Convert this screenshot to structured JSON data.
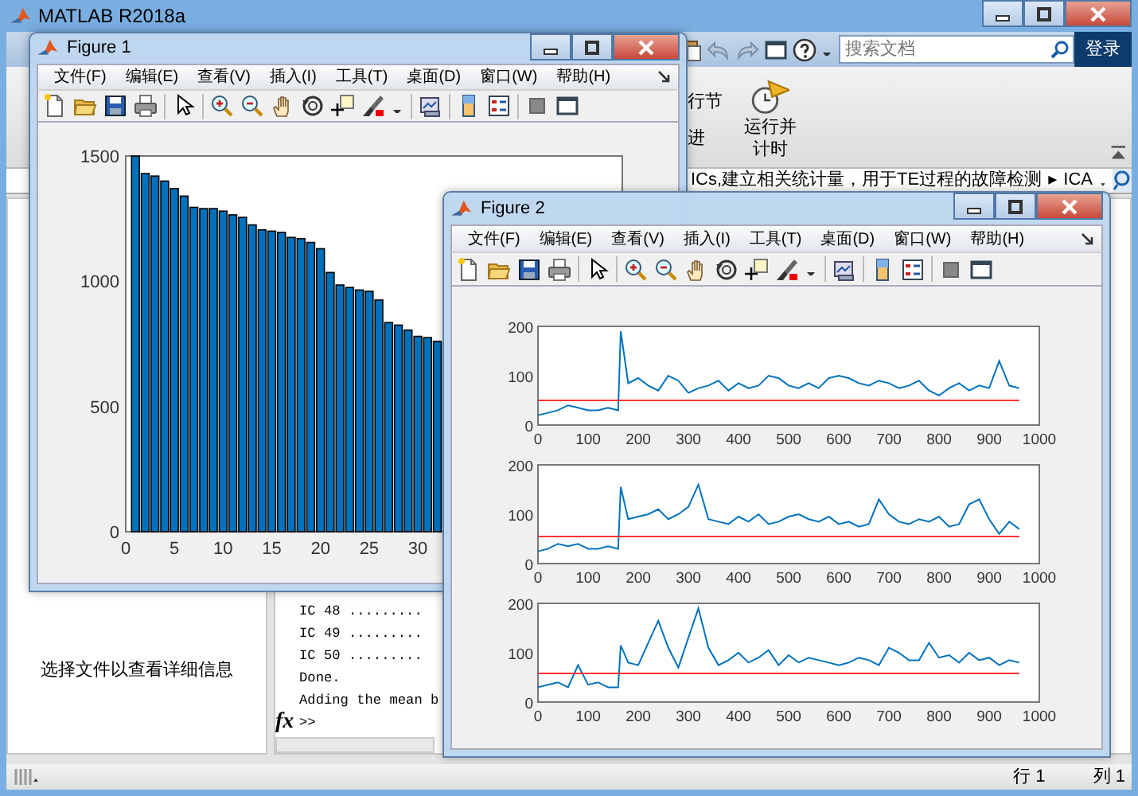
{
  "main_window": {
    "title": "MATLAB R2018a"
  },
  "search": {
    "placeholder": "搜索文档"
  },
  "login_button": "登录",
  "ribbon": {
    "labels": [
      "行节",
      "进"
    ],
    "run_and_time": "运行并计时"
  },
  "address_bar": {
    "path": "ICs,建立相关统计量，用于TE过程的故障检测",
    "separator": "▸",
    "folder": "ICA"
  },
  "details_panel": {
    "message": "选择文件以查看详细信息"
  },
  "command_window": {
    "lines": [
      "IC 48 .........",
      "IC 49 .........",
      "IC 50 .........",
      "Done.",
      "Adding the mean b"
    ],
    "fx": "fx",
    "prompt": ">>"
  },
  "status_bar": {
    "line": "行 1",
    "column": "列 1"
  },
  "figures": [
    {
      "title": "Figure 1",
      "kind": "bar",
      "menu": [
        "文件(F)",
        "编辑(E)",
        "查看(V)",
        "插入(I)",
        "工具(T)",
        "桌面(D)",
        "窗口(W)",
        "帮助(H)"
      ],
      "chart_data": {
        "type": "bar",
        "x": [
          1,
          2,
          3,
          4,
          5,
          6,
          7,
          8,
          9,
          10,
          11,
          12,
          13,
          14,
          15,
          16,
          17,
          18,
          19,
          20,
          21,
          22,
          23,
          24,
          25,
          26,
          27,
          28,
          29,
          30,
          31,
          32
        ],
        "values": [
          1500,
          1430,
          1420,
          1400,
          1370,
          1340,
          1295,
          1290,
          1290,
          1280,
          1265,
          1255,
          1225,
          1205,
          1200,
          1195,
          1175,
          1170,
          1155,
          1130,
          1035,
          985,
          975,
          965,
          960,
          925,
          835,
          825,
          805,
          780,
          775,
          760
        ],
        "xlim": [
          0,
          51
        ],
        "ylim": [
          0,
          1500
        ],
        "xticks": [
          0,
          5,
          10,
          15,
          20,
          25,
          30
        ],
        "yticks": [
          0,
          500,
          1000,
          1500
        ]
      }
    },
    {
      "title": "Figure 2",
      "kind": "subplots",
      "menu": [
        "文件(F)",
        "编辑(E)",
        "查看(V)",
        "插入(I)",
        "工具(T)",
        "桌面(D)",
        "窗口(W)",
        "帮助(H)"
      ],
      "subplots": [
        {
          "chart_data": {
            "type": "line",
            "x": [
              0,
              20,
              40,
              60,
              80,
              100,
              120,
              140,
              160,
              165,
              180,
              200,
              220,
              240,
              260,
              280,
              300,
              320,
              340,
              360,
              380,
              400,
              420,
              440,
              460,
              480,
              500,
              520,
              540,
              560,
              580,
              600,
              620,
              640,
              660,
              680,
              700,
              720,
              740,
              760,
              780,
              800,
              820,
              840,
              860,
              880,
              900,
              920,
              940,
              960
            ],
            "series": [
              {
                "color": "#0072bd",
                "values": [
                  20,
                  25,
                  30,
                  40,
                  35,
                  30,
                  30,
                  35,
                  30,
                  190,
                  85,
                  95,
                  80,
                  70,
                  100,
                  90,
                  65,
                  75,
                  80,
                  90,
                  70,
                  85,
                  75,
                  80,
                  100,
                  95,
                  80,
                  75,
                  85,
                  75,
                  95,
                  100,
                  95,
                  85,
                  80,
                  90,
                  85,
                  75,
                  80,
                  90,
                  70,
                  60,
                  75,
                  85,
                  70,
                  80,
                  75,
                  130,
                  80,
                  75
                ]
              },
              {
                "color": "#ff3333",
                "values": [
                  50,
                  50,
                  50,
                  50,
                  50,
                  50,
                  50,
                  50,
                  50,
                  50,
                  50,
                  50,
                  50,
                  50,
                  50,
                  50,
                  50,
                  50,
                  50,
                  50,
                  50,
                  50,
                  50,
                  50,
                  50,
                  50,
                  50,
                  50,
                  50,
                  50,
                  50,
                  50,
                  50,
                  50,
                  50,
                  50,
                  50,
                  50,
                  50,
                  50,
                  50,
                  50,
                  50,
                  50,
                  50,
                  50,
                  50,
                  50,
                  50,
                  50
                ]
              }
            ],
            "xlim": [
              0,
              1000
            ],
            "ylim": [
              0,
              200
            ],
            "xticks": [
              0,
              100,
              200,
              300,
              400,
              500,
              600,
              700,
              800,
              900,
              1000
            ],
            "yticks": [
              0,
              100,
              200
            ]
          }
        },
        {
          "chart_data": {
            "type": "line",
            "x": [
              0,
              20,
              40,
              60,
              80,
              100,
              120,
              140,
              160,
              165,
              180,
              200,
              220,
              240,
              260,
              280,
              300,
              320,
              340,
              360,
              380,
              400,
              420,
              440,
              460,
              480,
              500,
              520,
              540,
              560,
              580,
              600,
              620,
              640,
              660,
              680,
              700,
              720,
              740,
              760,
              780,
              800,
              820,
              840,
              860,
              880,
              900,
              920,
              940,
              960
            ],
            "series": [
              {
                "color": "#0072bd",
                "values": [
                  25,
                  30,
                  40,
                  35,
                  40,
                  30,
                  30,
                  35,
                  30,
                  155,
                  90,
                  95,
                  100,
                  110,
                  90,
                  100,
                  115,
                  160,
                  90,
                  85,
                  80,
                  95,
                  85,
                  100,
                  80,
                  85,
                  95,
                  100,
                  90,
                  85,
                  95,
                  80,
                  85,
                  75,
                  80,
                  130,
                  100,
                  85,
                  80,
                  90,
                  85,
                  95,
                  75,
                  80,
                  120,
                  130,
                  90,
                  60,
                  85,
                  70
                ]
              },
              {
                "color": "#ff3333",
                "values": [
                  55,
                  55,
                  55,
                  55,
                  55,
                  55,
                  55,
                  55,
                  55,
                  55,
                  55,
                  55,
                  55,
                  55,
                  55,
                  55,
                  55,
                  55,
                  55,
                  55,
                  55,
                  55,
                  55,
                  55,
                  55,
                  55,
                  55,
                  55,
                  55,
                  55,
                  55,
                  55,
                  55,
                  55,
                  55,
                  55,
                  55,
                  55,
                  55,
                  55,
                  55,
                  55,
                  55,
                  55,
                  55,
                  55,
                  55,
                  55,
                  55,
                  55
                ]
              }
            ],
            "xlim": [
              0,
              1000
            ],
            "ylim": [
              0,
              200
            ],
            "xticks": [
              0,
              100,
              200,
              300,
              400,
              500,
              600,
              700,
              800,
              900,
              1000
            ],
            "yticks": [
              0,
              100,
              200
            ]
          }
        },
        {
          "chart_data": {
            "type": "line",
            "x": [
              0,
              20,
              40,
              60,
              80,
              100,
              120,
              140,
              160,
              165,
              180,
              200,
              220,
              240,
              260,
              280,
              300,
              320,
              340,
              360,
              380,
              400,
              420,
              440,
              460,
              480,
              500,
              520,
              540,
              560,
              580,
              600,
              620,
              640,
              660,
              680,
              700,
              720,
              740,
              760,
              780,
              800,
              820,
              840,
              860,
              880,
              900,
              920,
              940,
              960
            ],
            "series": [
              {
                "color": "#0072bd",
                "values": [
                  30,
                  35,
                  40,
                  30,
                  75,
                  35,
                  40,
                  30,
                  30,
                  115,
                  80,
                  75,
                  120,
                  165,
                  110,
                  70,
                  130,
                  190,
                  110,
                  75,
                  85,
                  100,
                  80,
                  90,
                  105,
                  75,
                  95,
                  80,
                  90,
                  85,
                  80,
                  75,
                  80,
                  90,
                  85,
                  75,
                  110,
                  100,
                  85,
                  85,
                  120,
                  90,
                  95,
                  80,
                  100,
                  85,
                  90,
                  75,
                  85,
                  80
                ]
              },
              {
                "color": "#ff3333",
                "values": [
                  58,
                  58,
                  58,
                  58,
                  58,
                  58,
                  58,
                  58,
                  58,
                  58,
                  58,
                  58,
                  58,
                  58,
                  58,
                  58,
                  58,
                  58,
                  58,
                  58,
                  58,
                  58,
                  58,
                  58,
                  58,
                  58,
                  58,
                  58,
                  58,
                  58,
                  58,
                  58,
                  58,
                  58,
                  58,
                  58,
                  58,
                  58,
                  58,
                  58,
                  58,
                  58,
                  58,
                  58,
                  58,
                  58,
                  58,
                  58,
                  58,
                  58
                ]
              }
            ],
            "xlim": [
              0,
              1000
            ],
            "ylim": [
              0,
              200
            ],
            "xticks": [
              0,
              100,
              200,
              300,
              400,
              500,
              600,
              700,
              800,
              900,
              1000
            ],
            "yticks": [
              0,
              100,
              200
            ]
          }
        }
      ]
    }
  ]
}
